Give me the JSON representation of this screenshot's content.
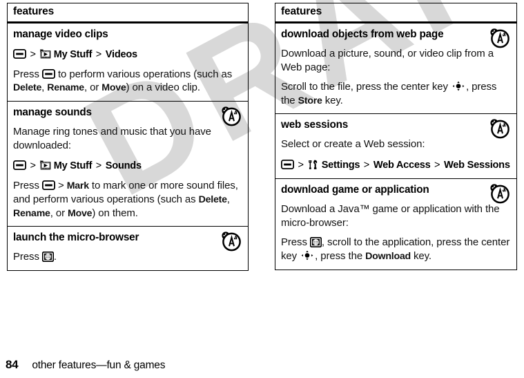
{
  "document": {
    "watermark_text": "DRAFT",
    "page_number": "84",
    "footer_text": "other features—fun & games"
  },
  "left_table": {
    "header": "features",
    "rows": [
      {
        "title": "manage video clips",
        "has_ota_icon": false,
        "blocks": [
          {
            "kind": "path",
            "parts": [
              {
                "t": "icon",
                "icon": "menu-key-icon"
              },
              {
                "t": "sep",
                "text": ">"
              },
              {
                "t": "icon",
                "icon": "my-stuff-filmstrip-icon"
              },
              {
                "t": "bold",
                "text": "My Stuff"
              },
              {
                "t": "sep",
                "text": ">"
              },
              {
                "t": "bold",
                "text": "Videos"
              }
            ]
          },
          {
            "kind": "para",
            "parts": [
              {
                "t": "text",
                "text": "Press "
              },
              {
                "t": "icon",
                "icon": "menu-key-icon"
              },
              {
                "t": "text",
                "text": " to perform various operations (such as "
              },
              {
                "t": "bold",
                "text": "Delete"
              },
              {
                "t": "text",
                "text": ", "
              },
              {
                "t": "bold",
                "text": "Rename"
              },
              {
                "t": "text",
                "text": ", or "
              },
              {
                "t": "bold",
                "text": "Move"
              },
              {
                "t": "text",
                "text": ") on a video clip."
              }
            ]
          }
        ]
      },
      {
        "title": "manage sounds",
        "has_ota_icon": true,
        "blocks": [
          {
            "kind": "para",
            "parts": [
              {
                "t": "text",
                "text": "Manage ring tones and music that you have downloaded:"
              }
            ]
          },
          {
            "kind": "path",
            "parts": [
              {
                "t": "icon",
                "icon": "menu-key-icon"
              },
              {
                "t": "sep",
                "text": ">"
              },
              {
                "t": "icon",
                "icon": "my-stuff-filmstrip-icon"
              },
              {
                "t": "bold",
                "text": "My Stuff"
              },
              {
                "t": "sep",
                "text": ">"
              },
              {
                "t": "bold",
                "text": "Sounds"
              }
            ]
          },
          {
            "kind": "para",
            "parts": [
              {
                "t": "text",
                "text": "Press "
              },
              {
                "t": "icon",
                "icon": "menu-key-icon"
              },
              {
                "t": "text",
                "text": " > "
              },
              {
                "t": "bold",
                "text": "Mark"
              },
              {
                "t": "text",
                "text": " to mark one or more sound files, and perform various operations (such as "
              },
              {
                "t": "bold",
                "text": "Delete"
              },
              {
                "t": "text",
                "text": ", "
              },
              {
                "t": "bold",
                "text": "Rename"
              },
              {
                "t": "text",
                "text": ", or "
              },
              {
                "t": "bold",
                "text": "Move"
              },
              {
                "t": "text",
                "text": ") on them."
              }
            ]
          }
        ]
      },
      {
        "title": "launch the micro-browser",
        "has_ota_icon": true,
        "blocks": [
          {
            "kind": "para",
            "parts": [
              {
                "t": "text",
                "text": "Press "
              },
              {
                "t": "icon",
                "icon": "browser-globe-key-icon"
              },
              {
                "t": "text",
                "text": "."
              }
            ]
          }
        ]
      }
    ]
  },
  "right_table": {
    "header": "features",
    "rows": [
      {
        "title": "download objects from web page",
        "has_ota_icon": true,
        "blocks": [
          {
            "kind": "para",
            "parts": [
              {
                "t": "text",
                "text": "Download a picture, sound, or video clip from a Web page:"
              }
            ]
          },
          {
            "kind": "para",
            "parts": [
              {
                "t": "text",
                "text": "Scroll to the file, press the center key "
              },
              {
                "t": "icon",
                "icon": "center-key-icon"
              },
              {
                "t": "text",
                "text": ", press the "
              },
              {
                "t": "bold",
                "text": "Store"
              },
              {
                "t": "text",
                "text": " key."
              }
            ]
          }
        ]
      },
      {
        "title": "web sessions",
        "has_ota_icon": true,
        "blocks": [
          {
            "kind": "para",
            "parts": [
              {
                "t": "text",
                "text": "Select or create a Web session:"
              }
            ]
          },
          {
            "kind": "path",
            "parts": [
              {
                "t": "icon",
                "icon": "menu-key-icon"
              },
              {
                "t": "sep",
                "text": ">"
              },
              {
                "t": "icon",
                "icon": "settings-tools-icon"
              },
              {
                "t": "bold",
                "text": "Settings"
              },
              {
                "t": "sep",
                "text": ">"
              },
              {
                "t": "bold",
                "text": "Web Access"
              },
              {
                "t": "sep",
                "text": ">"
              },
              {
                "t": "bold",
                "text": "Web Sessions"
              }
            ]
          }
        ]
      },
      {
        "title": "download game or application",
        "has_ota_icon": true,
        "blocks": [
          {
            "kind": "para",
            "parts": [
              {
                "t": "text",
                "text": "Download a Java™ game or application with the micro-browser:"
              }
            ]
          },
          {
            "kind": "para",
            "parts": [
              {
                "t": "text",
                "text": "Press "
              },
              {
                "t": "icon",
                "icon": "browser-globe-key-icon"
              },
              {
                "t": "text",
                "text": ", scroll to the application, press the center key "
              },
              {
                "t": "icon",
                "icon": "center-key-icon"
              },
              {
                "t": "text",
                "text": ", press the "
              },
              {
                "t": "bold",
                "text": "Download"
              },
              {
                "t": "text",
                "text": " key."
              }
            ]
          }
        ]
      }
    ]
  },
  "icons": {
    "menu-key-icon": "menu key (rounded rectangle with bar)",
    "my-stuff-filmstrip-icon": "film strip with play arrow",
    "settings-tools-icon": "wrench and screwdriver tools",
    "browser-globe-key-icon": "globe key",
    "center-key-icon": "center select key (dot with arrows)",
    "ota-icon": "over-the-air download antenna badge"
  },
  "colors": {
    "ink": "#000000",
    "paper": "#ffffff",
    "watermark": "#d8d8d8"
  }
}
